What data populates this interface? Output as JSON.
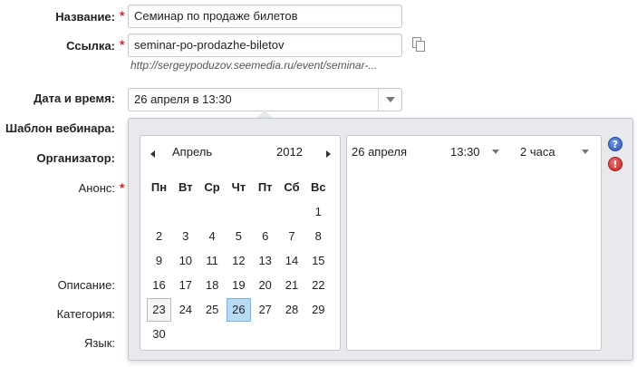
{
  "form": {
    "name_label": "Название:",
    "name_value": "Семинар по продаже билетов",
    "link_label": "Ссылка:",
    "link_value": "seminar-po-prodazhe-biletov",
    "link_hint": "http://sergeypoduzov.seemedia.ru/event/seminar-...",
    "datetime_label": "Дата и время:",
    "datetime_value": "26 апреля в 13:30",
    "template_label": "Шаблон вебинара:",
    "organizer_label": "Организатор:",
    "announce_label": "Анонс:",
    "description_label": "Описание:",
    "category_label": "Категория:",
    "language_label": "Язык:",
    "required_mark": "*"
  },
  "calendar": {
    "month": "Апрель",
    "year": "2012",
    "weekdays": [
      "Пн",
      "Вт",
      "Ср",
      "Чт",
      "Пт",
      "Сб",
      "Вс"
    ],
    "rows": [
      [
        "",
        "",
        "",
        "",
        "",
        "",
        "1"
      ],
      [
        "2",
        "3",
        "4",
        "5",
        "6",
        "7",
        "8"
      ],
      [
        "9",
        "10",
        "11",
        "12",
        "13",
        "14",
        "15"
      ],
      [
        "16",
        "17",
        "18",
        "19",
        "20",
        "21",
        "22"
      ],
      [
        "23",
        "24",
        "25",
        "26",
        "27",
        "28",
        "29"
      ],
      [
        "30",
        "",
        "",
        "",
        "",
        "",
        ""
      ]
    ],
    "today": "23",
    "selected": "26"
  },
  "time_entry": {
    "date": "26 апреля",
    "time": "13:30",
    "duration": "2 часа"
  },
  "icons": {
    "help": "?",
    "remove": "!"
  }
}
